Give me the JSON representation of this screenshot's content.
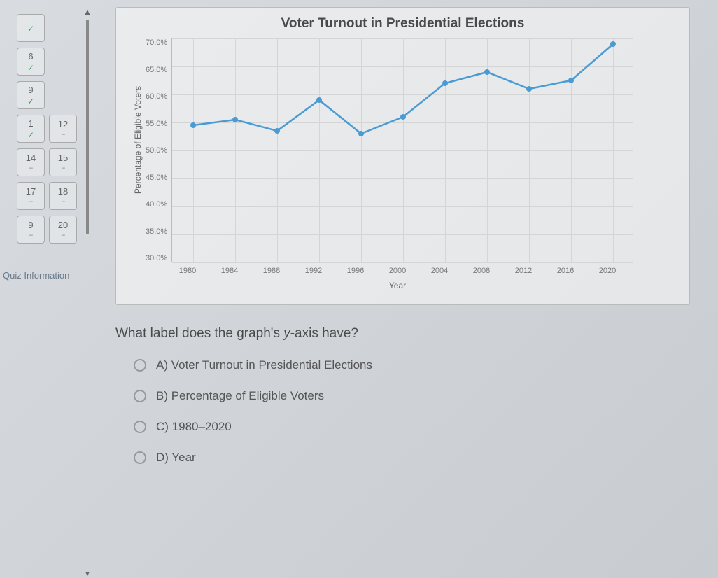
{
  "nav": {
    "rows": [
      [
        {
          "num": "",
          "mark": "check"
        }
      ],
      [
        {
          "num": "6",
          "mark": "check"
        }
      ],
      [
        {
          "num": "9",
          "mark": "check"
        }
      ],
      [
        {
          "num": "1",
          "mark": "check"
        },
        {
          "num": "12",
          "mark": "dash"
        }
      ],
      [
        {
          "num": "14",
          "mark": "dash"
        },
        {
          "num": "15",
          "mark": "dash"
        }
      ],
      [
        {
          "num": "17",
          "mark": "dash"
        },
        {
          "num": "18",
          "mark": "dash"
        }
      ],
      [
        {
          "num": "9",
          "mark": "dash"
        },
        {
          "num": "20",
          "mark": "dash"
        }
      ]
    ],
    "quiz_info": "Quiz Information"
  },
  "chart_data": {
    "type": "line",
    "title": "Voter Turnout in Presidential Elections",
    "xlabel": "Year",
    "ylabel": "Percentage of Eligible Voters",
    "ylim": [
      30,
      70
    ],
    "yticks": [
      "70.0%",
      "65.0%",
      "60.0%",
      "55.0%",
      "50.0%",
      "45.0%",
      "40.0%",
      "35.0%",
      "30.0%"
    ],
    "categories": [
      "1980",
      "1984",
      "1988",
      "1992",
      "1996",
      "2000",
      "2004",
      "2008",
      "2012",
      "2016",
      "2020"
    ],
    "values": [
      54.5,
      55.5,
      53.5,
      59.0,
      53.0,
      56.0,
      62.0,
      64.0,
      61.0,
      62.5,
      69.0
    ]
  },
  "question": {
    "prompt_pre": "What label does the graph's ",
    "prompt_y": "y",
    "prompt_post": "-axis have?",
    "options": [
      {
        "letter": "A)",
        "text": "Voter Turnout in Presidential Elections"
      },
      {
        "letter": "B)",
        "text": "Percentage of Eligible Voters"
      },
      {
        "letter": "C)",
        "text": "1980–2020"
      },
      {
        "letter": "D)",
        "text": "Year"
      }
    ]
  }
}
